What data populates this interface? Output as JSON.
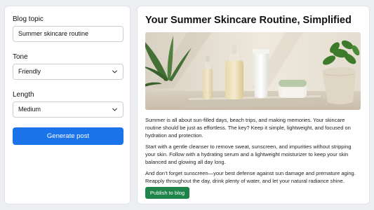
{
  "form": {
    "topic_label": "Blog topic",
    "topic_value": "Summer skincare routine",
    "tone_label": "Tone",
    "tone_value": "Friendly",
    "length_label": "Length",
    "length_value": "Medium",
    "generate_label": "Generate post"
  },
  "post": {
    "title": "Your Summer Skincare Routine, Simplified",
    "paragraphs": [
      "Summer is all about sun-filled days, beach trips, and making memories. Your skincare routine should be just as effortless. The key? Keep it simple, lightweight, and focused on hydration and protection.",
      "Start with a gentle cleanser to remove sweat, sunscreen, and impurities without stripping your skin. Follow with a hydrating serum and a lightweight moisturizer to keep your skin balanced and glowing all day long.",
      "And don’t forget sunscreen—your best defense against sun damage and premature aging. Reapply throughout the day, drink plenty of water, and let your natural radiance shine."
    ],
    "publish_label": "Publish to blog"
  },
  "colors": {
    "primary": "#1a73e8",
    "publish": "#1e8449",
    "background": "#eceef2"
  },
  "icons": {
    "select": "chevron-down-icon"
  }
}
